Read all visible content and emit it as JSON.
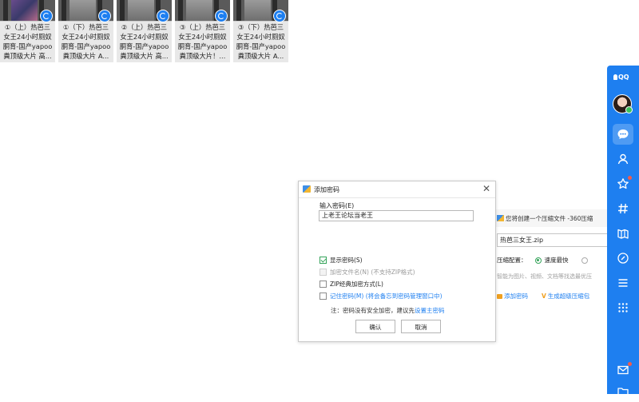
{
  "thumbnails": [
    {
      "caption": "①（上）热芭三\n女王24小时厕奴\n胴育-国产yapoo\n粪顶级大片 高..."
    },
    {
      "caption": "①（下）热芭三\n女王24小时厕奴\n胴育-国产yapoo\n粪顶级大片 A..."
    },
    {
      "caption": "②（上）热芭三\n女王24小时厕奴\n胴育-国产yapoo\n粪顶级大片 高..."
    },
    {
      "caption": "③（上）热芭三\n女王24小时厕奴\n胴育-国产yapoo\n粪顶级大片！..."
    },
    {
      "caption": "③（下）热芭三\n女王24小时厕奴\n胴育-国产yapoo\n粪顶级大片 A..."
    }
  ],
  "password_dialog": {
    "title": "添加密码",
    "input_label": "输入密码(E)",
    "password_value": "上老王论坛当老王",
    "options": {
      "show_password": "显示密码(S)",
      "encrypt_filename": "加密文件名(N) (不支持ZIP格式)",
      "zip_classic": "ZIP经典加密方式(L)",
      "remember_password": "记住密码(M) (将会备忘到密码管理窗口中)"
    },
    "note_prefix": "注：密码没有安全加密，建议先",
    "note_link": "设置主密码",
    "confirm_label": "确认",
    "cancel_label": "取消"
  },
  "compress_window": {
    "title": "您将创建一个压缩文件 -360压缩",
    "filename": "热芭三女王.zip",
    "config_label": "压缩配置：",
    "config_selected": "速度最快",
    "hint": "智能为图片、视频、文档等找选最优压",
    "add_password_link": "添加密码",
    "super_compress_link": "生成超级压缩包"
  },
  "qq_sidebar": {
    "brand": "QQ",
    "accent_color": "#1e7ff0",
    "icons": [
      "chat-icon",
      "contacts-icon",
      "star-icon",
      "hash-icon",
      "map-icon",
      "link-icon",
      "menu-icon",
      "grid-icon",
      "mail-icon",
      "folder-icon"
    ]
  }
}
